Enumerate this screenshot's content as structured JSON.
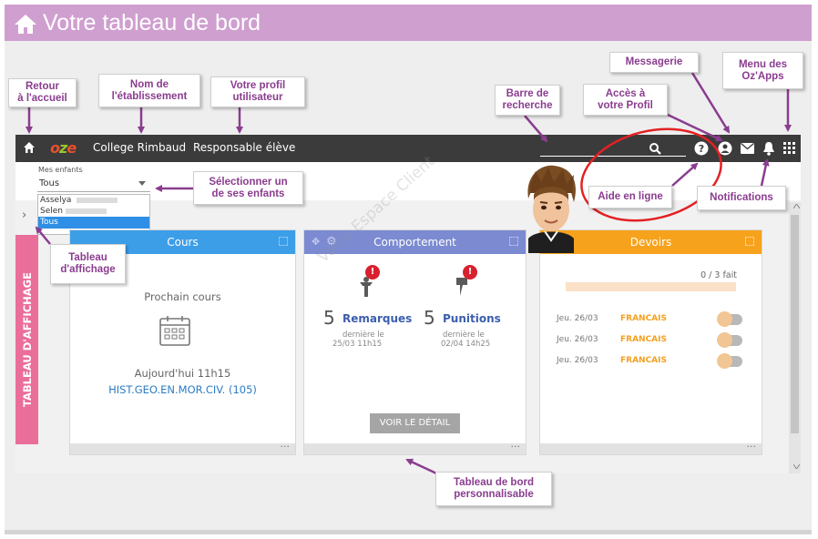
{
  "banner": {
    "title": "Votre tableau de bord"
  },
  "appbar": {
    "logo": "oze",
    "school": "College Rimbaud",
    "profile": "Responsable élève"
  },
  "selector": {
    "label": "Mes enfants",
    "value": "Tous",
    "options": [
      "Asselya",
      "Selen",
      "Tous"
    ],
    "selected_index": 2
  },
  "sidetab": {
    "label": "TABLEAU D'AFFICHAGE"
  },
  "widgets": {
    "cours": {
      "title": "Cours",
      "color": "#3d9ee8",
      "next_label": "Prochain cours",
      "time": "Aujourd'hui 11h15",
      "course": "HIST.GEO.EN.MOR.CIV. (105)",
      "more": "..."
    },
    "comportement": {
      "title": "Comportement",
      "color": "#7b8ad1",
      "remarques_count": "5",
      "remarques_label": "Remarques",
      "remarques_date_label": "dernière le",
      "remarques_date": "25/03 11h15",
      "punitions_count": "5",
      "punitions_label": "Punitions",
      "punitions_date_label": "dernière le",
      "punitions_date": "02/04 14h25",
      "badge": "!",
      "button": "VOIR LE DÉTAIL",
      "more": "..."
    },
    "devoirs": {
      "title": "Devoirs",
      "color": "#f7a21d",
      "progress_text": "0 / 3 fait",
      "progress": 0,
      "rows": [
        {
          "date": "Jeu. 26/03",
          "subject": "FRANCAIS"
        },
        {
          "date": "Jeu. 26/03",
          "subject": "FRANCAIS"
        },
        {
          "date": "Jeu. 26/03",
          "subject": "FRANCAIS"
        }
      ],
      "more": "..."
    }
  },
  "callouts": {
    "retour": "Retour\nà l'accueil",
    "nom": "Nom de\nl'établissement",
    "profil_user": "Votre profil\nutilisateur",
    "selection": "Sélectionner un\nde ses enfants",
    "tableau_affichage": "Tableau\nd'affichage",
    "recherche": "Barre de\nrecherche",
    "acces_profil": "Accès à\nvotre Profil",
    "messagerie": "Messagerie",
    "menu_apps": "Menu des\nOz'Apps",
    "aide": "Aide en ligne",
    "notifications": "Notifications",
    "tableau_bord": "Tableau de bord\npersonnalisable"
  },
  "watermark": "Votre Espace Client",
  "colors": {
    "banner": "#cf9fcf",
    "callout_text": "#8a3d8f",
    "arrow": "#8a3d8f",
    "appbar": "#3b3b3b",
    "sidetab": "#ea6e9a",
    "highlight": "#e32124",
    "badge": "#d9202e"
  }
}
